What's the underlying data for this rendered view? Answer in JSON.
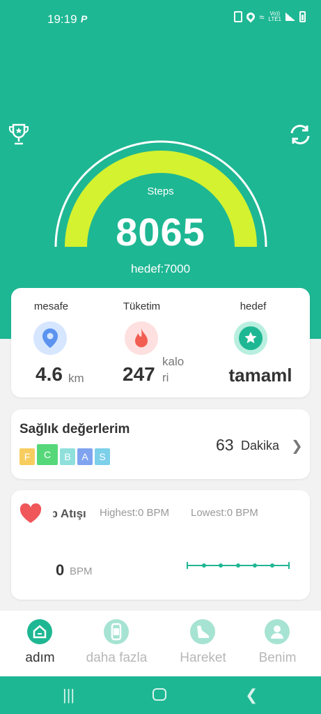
{
  "status_bar": {
    "time": "19:19",
    "carrier_icon": "P",
    "volte": "Vo))\nLTE1"
  },
  "header": {
    "trophy_icon": "trophy-icon",
    "sync_icon": "sync-icon"
  },
  "steps": {
    "label": "Steps",
    "value": "8065",
    "goal_text": "hedef:7000",
    "progress": 1.0
  },
  "stats": {
    "distance": {
      "title": "mesafe",
      "value": "4.6",
      "unit": "km",
      "icon": "location-icon"
    },
    "calories": {
      "title": "Tüketim",
      "value": "247",
      "unit_line1": "kalo",
      "unit_line2": "ri",
      "icon": "flame-icon"
    },
    "goal": {
      "title": "hedef",
      "value": "tamaml",
      "icon": "star-icon"
    }
  },
  "health": {
    "title": "Sağlık değerlerim",
    "badges": [
      "F",
      "C",
      "B",
      "A",
      "S"
    ],
    "minutes": "63",
    "unit": "Dakika"
  },
  "heart_rate": {
    "title": "Kalp Atışı",
    "highest": "Highest:0  BPM",
    "lowest": "Lowest:0  BPM",
    "value": "0",
    "unit": "BPM"
  },
  "bottom_nav": {
    "items": [
      {
        "label": "adım",
        "active": true
      },
      {
        "label": "daha fazla",
        "active": false
      },
      {
        "label": "Hareket",
        "active": false
      },
      {
        "label": "Benim",
        "active": false
      }
    ]
  },
  "colors": {
    "brand": "#1eb793",
    "gauge": "#d4f230"
  }
}
